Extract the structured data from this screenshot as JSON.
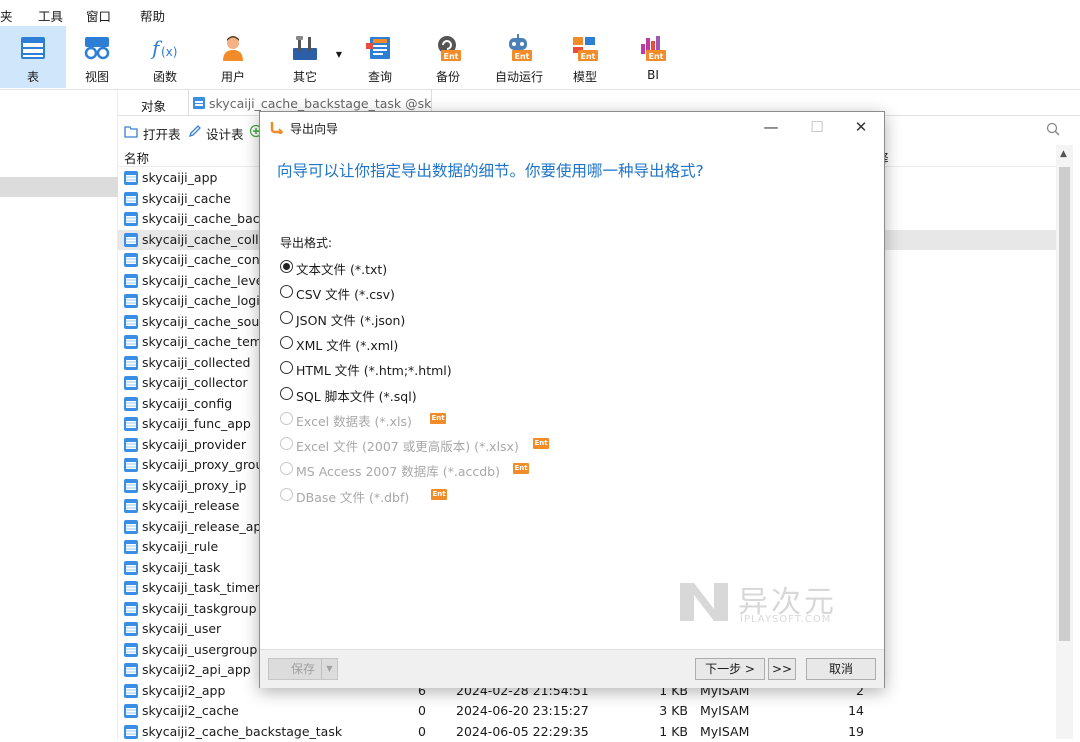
{
  "menu": [
    "夹",
    "工具",
    "窗口",
    "帮助"
  ],
  "toolbar": [
    {
      "label": "表",
      "icon": "table-icon"
    },
    {
      "label": "视图",
      "icon": "view-icon"
    },
    {
      "label": "函数",
      "icon": "function-icon"
    },
    {
      "label": "用户",
      "icon": "user-icon"
    },
    {
      "label": "其它",
      "icon": "tools-icon"
    },
    {
      "label": "查询",
      "icon": "query-icon"
    },
    {
      "label": "备份",
      "icon": "backup-icon"
    },
    {
      "label": "自动运行",
      "icon": "robot-icon"
    },
    {
      "label": "模型",
      "icon": "model-icon"
    },
    {
      "label": "BI",
      "icon": "bi-chart-icon"
    }
  ],
  "ent_badge": "Ent",
  "tabs": {
    "objects": "对象",
    "active_tab": "skycaiji_cache_backstage_task @sky..."
  },
  "object_toolbar": {
    "open_table": "打开表",
    "design_table": "设计表"
  },
  "columns": {
    "name": "名称",
    "comment_partial": "释"
  },
  "table_rows": [
    {
      "name": "skycaiji_app"
    },
    {
      "name": "skycaiji_cache"
    },
    {
      "name": "skycaiji_cache_backst"
    },
    {
      "name": "skycaiji_cache_collecti"
    },
    {
      "name": "skycaiji_cache_cont_u"
    },
    {
      "name": "skycaiji_cache_level_u"
    },
    {
      "name": "skycaiji_cache_login"
    },
    {
      "name": "skycaiji_cache_source"
    },
    {
      "name": "skycaiji_cache_temp"
    },
    {
      "name": "skycaiji_collected"
    },
    {
      "name": "skycaiji_collector"
    },
    {
      "name": "skycaiji_config"
    },
    {
      "name": "skycaiji_func_app"
    },
    {
      "name": "skycaiji_provider"
    },
    {
      "name": "skycaiji_proxy_group"
    },
    {
      "name": "skycaiji_proxy_ip"
    },
    {
      "name": "skycaiji_release"
    },
    {
      "name": "skycaiji_release_app"
    },
    {
      "name": "skycaiji_rule"
    },
    {
      "name": "skycaiji_task"
    },
    {
      "name": "skycaiji_task_timer"
    },
    {
      "name": "skycaiji_taskgroup"
    },
    {
      "name": "skycaiji_user"
    },
    {
      "name": "skycaiji_usergroup"
    },
    {
      "name": "skycaiji2_api_app"
    },
    {
      "name": "skycaiji2_app",
      "rows": "6",
      "modified": "2024-02-28 21:54:51",
      "size": "1 KB",
      "engine": "MyISAM",
      "auto_inc": "2"
    },
    {
      "name": "skycaiji2_cache",
      "rows": "0",
      "modified": "2024-06-20 23:15:27",
      "size": "3 KB",
      "engine": "MyISAM",
      "auto_inc": "14"
    },
    {
      "name": "skycaiji2_cache_backstage_task",
      "rows": "0",
      "modified": "2024-06-05 22:29:35",
      "size": "1 KB",
      "engine": "MyISAM",
      "auto_inc": "19"
    }
  ],
  "dialog": {
    "title": "导出向导",
    "question": "向导可以让你指定导出数据的细节。你要使用哪一种导出格式?",
    "format_label": "导出格式:",
    "options": [
      {
        "label": "文本文件 (*.txt)",
        "selected": true,
        "enabled": true
      },
      {
        "label": "CSV 文件 (*.csv)",
        "selected": false,
        "enabled": true
      },
      {
        "label": "JSON 文件 (*.json)",
        "selected": false,
        "enabled": true
      },
      {
        "label": "XML 文件 (*.xml)",
        "selected": false,
        "enabled": true
      },
      {
        "label": "HTML 文件 (*.htm;*.html)",
        "selected": false,
        "enabled": true
      },
      {
        "label": "SQL 脚本文件 (*.sql)",
        "selected": false,
        "enabled": true
      },
      {
        "label": "Excel 数据表 (*.xls)",
        "selected": false,
        "enabled": false,
        "ent": true
      },
      {
        "label": "Excel 文件 (2007 或更高版本) (*.xlsx)",
        "selected": false,
        "enabled": false,
        "ent": true
      },
      {
        "label": "MS Access 2007 数据库 (*.accdb)",
        "selected": false,
        "enabled": false,
        "ent": true
      },
      {
        "label": "DBase 文件 (*.dbf)",
        "selected": false,
        "enabled": false,
        "ent": true
      }
    ],
    "buttons": {
      "save": "保存",
      "next": "下一步 >",
      "last": ">>",
      "cancel": "取消"
    }
  },
  "watermark": {
    "text": "异次元",
    "sub": "IPLAYSOFT.COM"
  },
  "colors": {
    "accent": "#1e74c8",
    "active_tool": "#cfe6fb",
    "ent_badge": "#f28c28"
  }
}
